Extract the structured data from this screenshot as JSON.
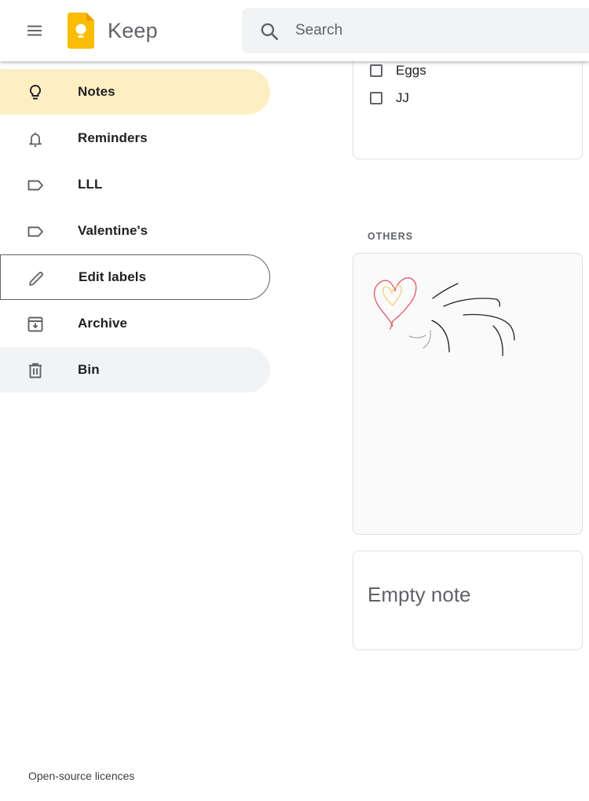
{
  "header": {
    "menu_icon": "hamburger-menu-icon",
    "logo_icon": "keep-logo-icon",
    "app_title": "Keep",
    "search": {
      "icon": "search-icon",
      "placeholder": "Search",
      "value": ""
    }
  },
  "sidebar": {
    "items": [
      {
        "label": "Notes",
        "icon": "lightbulb-icon",
        "state": "active"
      },
      {
        "label": "Reminders",
        "icon": "bell-icon",
        "state": "default"
      },
      {
        "label": "LLL",
        "icon": "label-icon",
        "state": "default"
      },
      {
        "label": "Valentine's",
        "icon": "label-icon",
        "state": "default"
      },
      {
        "label": "Edit labels",
        "icon": "pencil-icon",
        "state": "focused"
      },
      {
        "label": "Archive",
        "icon": "archive-icon",
        "state": "default"
      },
      {
        "label": "Bin",
        "icon": "trash-icon",
        "state": "hover"
      }
    ],
    "footer_link": "Open-source licences"
  },
  "colors": {
    "active_item_bg": "#feefc3",
    "hover_item_bg": "#f1f3f4",
    "search_bg": "#f1f3f4",
    "logo_yellow": "#fbbc04",
    "heart_outer": "#e06070",
    "heart_inner": "#f0d890"
  },
  "notes": {
    "pinned_list": {
      "items": [
        {
          "text": "Eggs",
          "checked": false
        },
        {
          "text": "JJ",
          "checked": false
        }
      ]
    },
    "others_label": "OTHERS",
    "drawing_note": {
      "type": "drawing",
      "description": "heart sketch with black strokes"
    },
    "empty_note": {
      "title": "Empty note"
    }
  }
}
